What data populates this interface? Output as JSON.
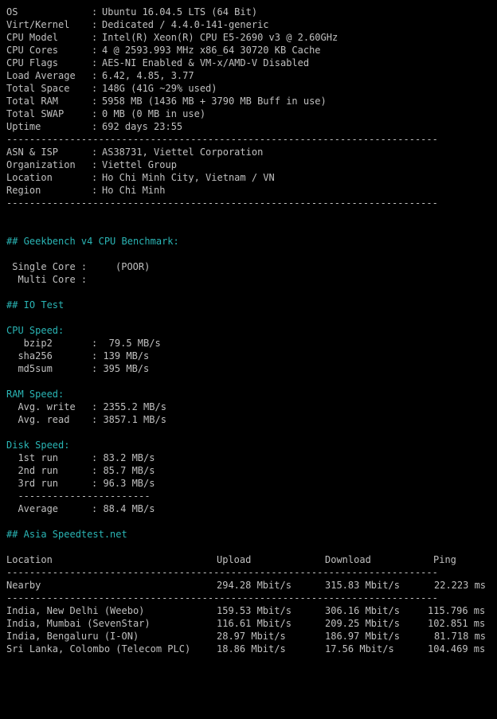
{
  "sysinfo": {
    "os": {
      "label": "OS",
      "value": "Ubuntu 16.04.5 LTS (64 Bit)"
    },
    "virt": {
      "label": "Virt/Kernel",
      "value": "Dedicated / 4.4.0-141-generic"
    },
    "cpu_model": {
      "label": "CPU Model",
      "value": "Intel(R) Xeon(R) CPU E5-2690 v3 @ 2.60GHz"
    },
    "cpu_cores": {
      "label": "CPU Cores",
      "value": "4 @ 2593.993 MHz x86_64 30720 KB Cache"
    },
    "cpu_flags": {
      "label": "CPU Flags",
      "value": "AES-NI Enabled & VM-x/AMD-V Disabled"
    },
    "load": {
      "label": "Load Average",
      "value": "6.42, 4.85, 3.77"
    },
    "space": {
      "label": "Total Space",
      "value": "148G (41G ~29% used)"
    },
    "ram": {
      "label": "Total RAM",
      "value": "5958 MB (1436 MB + 3790 MB Buff in use)"
    },
    "swap": {
      "label": "Total SWAP",
      "value": "0 MB (0 MB in use)"
    },
    "uptime": {
      "label": "Uptime",
      "value": "692 days 23:55"
    }
  },
  "separator": ":",
  "divider": "---------------------------------------------------------------------------",
  "network": {
    "asn": {
      "label": "ASN & ISP",
      "value": "AS38731, Viettel Corporation"
    },
    "org": {
      "label": "Organization",
      "value": "Viettel Group"
    },
    "location": {
      "label": "Location",
      "value": "Ho Chi Minh City, Vietnam / VN"
    },
    "region": {
      "label": "Region",
      "value": "Ho Chi Minh"
    }
  },
  "geekbench": {
    "heading": "## Geekbench v4 CPU Benchmark:",
    "single_label": " Single Core :",
    "single_value": "(POOR)",
    "multi_label": "  Multi Core :"
  },
  "io": {
    "heading": "## IO Test",
    "cpu_speed": {
      "title": "CPU Speed:",
      "bzip2": {
        "label": "   bzip2",
        "value": ":  79.5 MB/s"
      },
      "sha256": {
        "label": "  sha256",
        "value": ": 139 MB/s"
      },
      "md5sum": {
        "label": "  md5sum",
        "value": ": 395 MB/s"
      }
    },
    "ram_speed": {
      "title": "RAM Speed:",
      "write": {
        "label": "  Avg. write",
        "value": ": 2355.2 MB/s"
      },
      "read": {
        "label": "  Avg. read",
        "value": ": 3857.1 MB/s"
      }
    },
    "disk_speed": {
      "title": "Disk Speed:",
      "run1": {
        "label": "  1st run",
        "value": ": 83.2 MB/s"
      },
      "run2": {
        "label": "  2nd run",
        "value": ": 85.7 MB/s"
      },
      "run3": {
        "label": "  3rd run",
        "value": ": 96.3 MB/s"
      },
      "divider": "  -----------------------",
      "average": {
        "label": "  Average",
        "value": ": 88.4 MB/s"
      }
    }
  },
  "speedtest": {
    "heading": "## Asia Speedtest.net",
    "headers": {
      "location": "Location",
      "upload": "Upload",
      "download": "Download",
      "ping": "Ping"
    },
    "nearby": {
      "location": "Nearby",
      "upload": "294.28 Mbit/s",
      "download": "315.83 Mbit/s",
      "ping": "22.223 ms"
    },
    "rows": [
      {
        "location": "India, New Delhi (Weebo)",
        "upload": "159.53 Mbit/s",
        "download": "306.16 Mbit/s",
        "ping": "115.796 ms"
      },
      {
        "location": "India, Mumbai (SevenStar)",
        "upload": "116.61 Mbit/s",
        "download": "209.25 Mbit/s",
        "ping": "102.851 ms"
      },
      {
        "location": "India, Bengaluru (I-ON)",
        "upload": "28.97 Mbit/s",
        "download": "186.97 Mbit/s",
        "ping": "81.718 ms"
      },
      {
        "location": "Sri Lanka, Colombo (Telecom PLC)",
        "upload": "18.86 Mbit/s",
        "download": "17.56 Mbit/s",
        "ping": "104.469 ms"
      }
    ]
  },
  "colors": {
    "background": "#000000",
    "text": "#c0c0c0",
    "heading": "#2ab5b5"
  }
}
